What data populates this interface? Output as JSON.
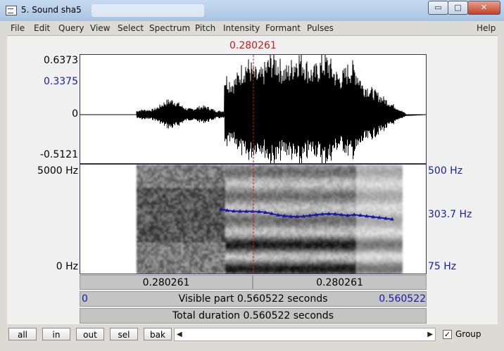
{
  "window": {
    "title": "5. Sound sha5",
    "minimize_glyph": "▭",
    "maximize_glyph": "□",
    "close_glyph": "✕"
  },
  "menu": [
    "File",
    "Edit",
    "Query",
    "View",
    "Select",
    "Spectrum",
    "Pitch",
    "Intensity",
    "Formant",
    "Pulses",
    "Help"
  ],
  "cursor_time": "0.280261",
  "waveform": {
    "max": "0.6373",
    "mid_marker": "0.3375",
    "zero": "0",
    "min": "-0.5121"
  },
  "spectrogram": {
    "freq_top": "5000 Hz",
    "freq_bottom": "0 Hz",
    "pitch_top": "500 Hz",
    "pitch_mid": "303.7 Hz",
    "pitch_bottom": "75 Hz"
  },
  "time_bars": {
    "left_segment": "0.280261",
    "right_segment": "0.280261",
    "visible_start": "0",
    "visible_label": "Visible part 0.560522 seconds",
    "visible_end": "0.560522",
    "total_label": "Total duration 0.560522 seconds"
  },
  "buttons": {
    "all": "all",
    "in": "in",
    "out": "out",
    "sel": "sel",
    "bak": "bak"
  },
  "group_label": "Group",
  "group_checked": true,
  "colors": {
    "cursor": "#cc1a1a",
    "pitch": "#1a1aa6"
  }
}
